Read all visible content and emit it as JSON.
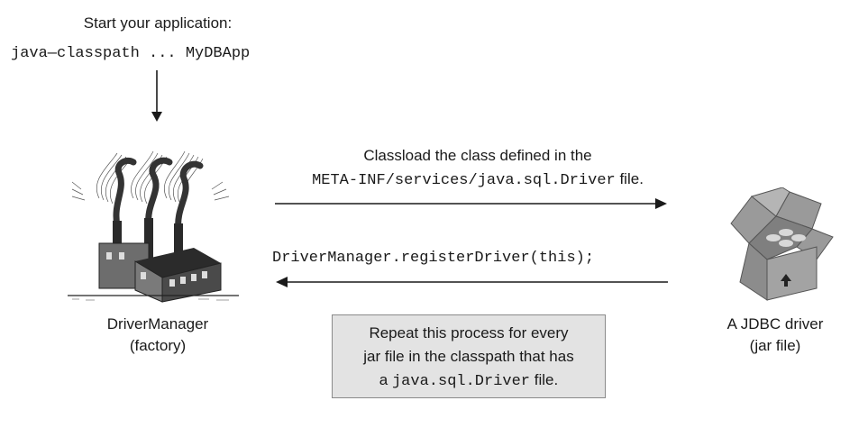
{
  "start": {
    "title": "Start your application:",
    "command": "java—classpath ... MyDBApp"
  },
  "driver_manager": {
    "name": "DriverManager",
    "role": "(factory)"
  },
  "messages": {
    "classload_line1": "Classload the class defined in the",
    "classload_path": "META-INF/services/java.sql.Driver",
    "classload_suffix": " file.",
    "register_call": "DriverManager.registerDriver(this);"
  },
  "repeat_note": {
    "line1": "Repeat this process for every",
    "line2": "jar file in the classpath that has",
    "line3_prefix": "a ",
    "line3_code": "java.sql.Driver",
    "line3_suffix": " file."
  },
  "jdbc_driver": {
    "name": "A JDBC driver",
    "role": "(jar file)"
  },
  "icons": [
    "factory-icon",
    "open-box-icon"
  ]
}
